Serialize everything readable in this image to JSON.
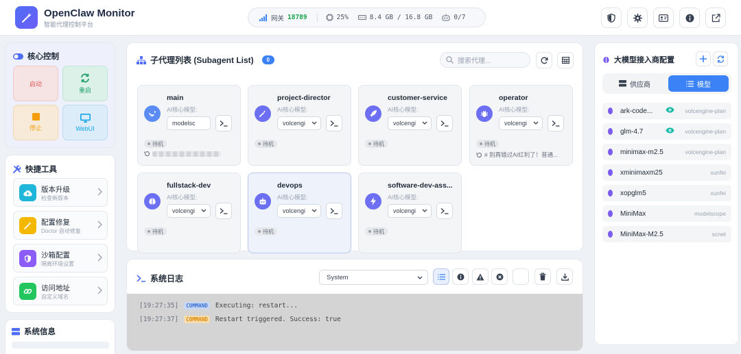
{
  "app": {
    "title": "OpenClaw Monitor",
    "subtitle": "智能代理控制平台"
  },
  "stats": {
    "gateway_label": "网关",
    "gateway_value": "18789",
    "cpu": "25%",
    "memory": "8.4 GB / 16.8 GB",
    "agents": "0/7"
  },
  "core": {
    "title": "核心控制",
    "buttons": [
      {
        "label": "启动",
        "color": "#e05b5b"
      },
      {
        "label": "重启",
        "color": "#22a06b"
      },
      {
        "label": "停止",
        "color": "#f59e0b"
      },
      {
        "label": "WebUI",
        "color": "#0ea5e9"
      }
    ]
  },
  "tools": {
    "title": "快捷工具",
    "items": [
      {
        "title": "版本升级",
        "desc": "检查新版本"
      },
      {
        "title": "配置修复",
        "desc": "Doctor 自动修复"
      },
      {
        "title": "沙箱配置",
        "desc": "隔离环境设置"
      },
      {
        "title": "访问地址",
        "desc": "自定义域名"
      }
    ]
  },
  "sysinfo": {
    "title": "系统信息"
  },
  "subagents": {
    "title": "子代理列表 (Subagent List)",
    "count": "0",
    "search_placeholder": "搜索代理...",
    "model_label": "AI核心模型:",
    "status_label": "待机",
    "items": [
      {
        "name": "main",
        "model": "modelsc",
        "last": ""
      },
      {
        "name": "project-director",
        "model": "volcengi",
        "last": ""
      },
      {
        "name": "customer-service",
        "model": "volcengi",
        "last": ""
      },
      {
        "name": "operator",
        "model": "volcengi",
        "last": "# 别再错过AI红利了！普通..."
      },
      {
        "name": "fullstack-dev",
        "model": "volcengi",
        "last": ""
      },
      {
        "name": "devops",
        "model": "volcengi",
        "last": ""
      },
      {
        "name": "software-dev-ass...",
        "model": "volcengi",
        "last": ""
      }
    ]
  },
  "logs": {
    "title": "系统日志",
    "filter": "System",
    "lines": [
      {
        "time": "[19:27:35]",
        "tag": "COMMAND",
        "text": "Executing: restart..."
      },
      {
        "time": "[19:27:37]",
        "tag": "COMMAND",
        "text": "Restart triggered. Success: true"
      }
    ]
  },
  "providers": {
    "title": "大模型接入商配置",
    "tab_providers": "供应商",
    "tab_models": "模型",
    "models": [
      {
        "name": "ark-code...",
        "provider": "volcengine-plan",
        "eye": true
      },
      {
        "name": "glm-4.7",
        "provider": "volcengine-plan",
        "eye": true
      },
      {
        "name": "minimax-m2.5",
        "provider": "volcengine-plan",
        "eye": false
      },
      {
        "name": "xminimaxm25",
        "provider": "xunfei",
        "eye": false
      },
      {
        "name": "xopglm5",
        "provider": "xunfei",
        "eye": false
      },
      {
        "name": "MiniMax",
        "provider": "modelscope",
        "eye": false
      },
      {
        "name": "MiniMax-M2.5",
        "provider": "scnet",
        "eye": false
      }
    ]
  },
  "colors": {
    "accent": "#3b82f6",
    "brand": "#5b63f5",
    "success": "#16a34a"
  }
}
